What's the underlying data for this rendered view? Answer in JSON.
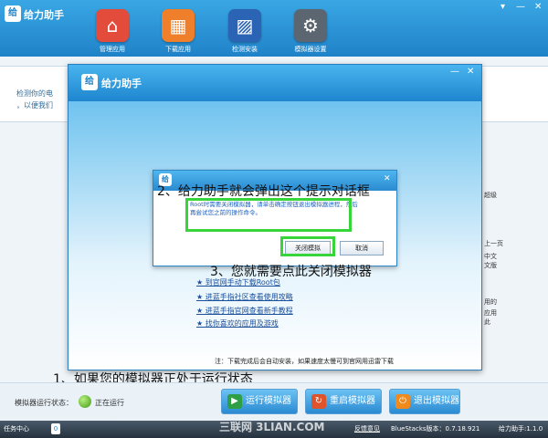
{
  "app": {
    "title": "给力助手",
    "logo_text": "给"
  },
  "nav": [
    {
      "label": "管理应用",
      "icon": "home-icon",
      "color": "#e34b3a"
    },
    {
      "label": "下载应用",
      "icon": "grid-icon",
      "color": "#ef7f2a"
    },
    {
      "label": "检测安装",
      "icon": "map-icon",
      "color": "#2b64b5"
    },
    {
      "label": "模拟器设置",
      "icon": "gear-icon",
      "color": "#5c6670"
    }
  ],
  "window_controls": {
    "skin": "▾",
    "minimize": "—",
    "close": "✕"
  },
  "background": {
    "info_line1": "检测你的电",
    "info_line2": "，以便我们",
    "side_right1": "超级",
    "side_right2": "上一页",
    "side_right3": "中文 文版",
    "side_right4": "用的",
    "side_right5": "应用 此"
  },
  "main_dialog": {
    "title": "给力助手",
    "minimize": "—",
    "close": "✕",
    "links": [
      "★ 到官网手动下载Root包",
      "★ 进蓝手指社区查看使用攻略",
      "★ 进蓝手指官网查看新手教程",
      "★ 找你喜欢的应用及游戏"
    ],
    "note": "注：下载完成后会自动安装，如果速度太慢可到官网用迅雷下载"
  },
  "root_dialog": {
    "close": "✕",
    "message": "Root时需要关闭模拟器，请单击确定按钮退出模拟器进程，然后再尝试您之前的操作命令。",
    "close_emulator_btn": "关闭模拟",
    "cancel_btn": "取消"
  },
  "annotations": {
    "a1": "1、如果您的模拟器正处于运行状态",
    "a2": "2、给力助手就会弹出这个提示对话框",
    "a3": "3、您就需要点此关闭模拟器"
  },
  "status": {
    "label": "模拟器运行状态：",
    "value": "正在运行",
    "dot_color": "#56b82c"
  },
  "buttons": {
    "run": "运行模拟器",
    "restart": "重启模拟器",
    "exit": "退出模拟器"
  },
  "taskbar": {
    "start": "任务中心",
    "badge": "0",
    "feedback": "反馈意见",
    "version": "BlueStacks版本：0.7.18.921",
    "helper_version": "给力助手:1.1.0",
    "watermark": "三联网 3LIAN.COM"
  }
}
